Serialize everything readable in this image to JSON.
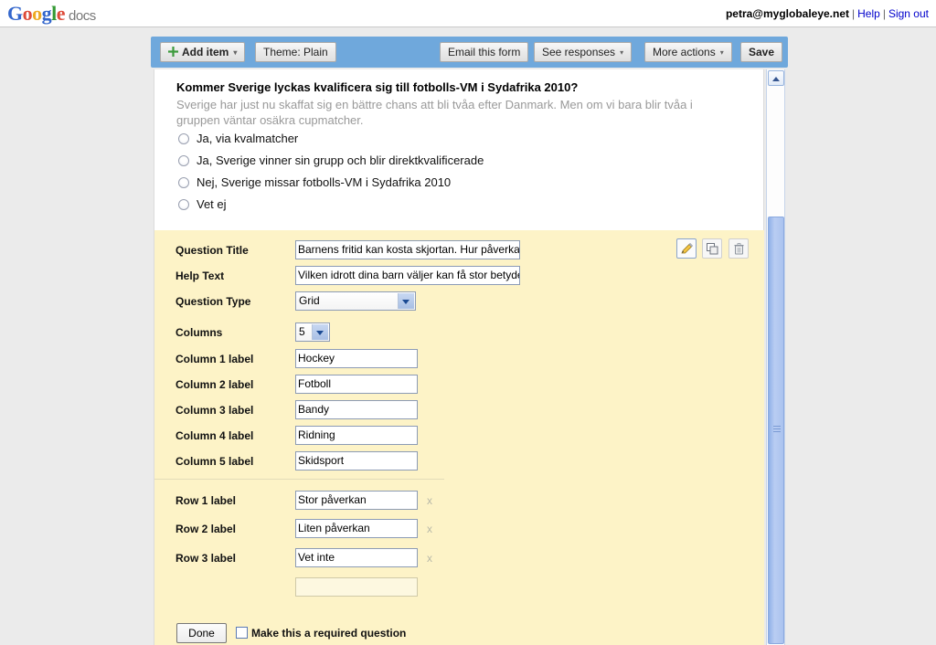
{
  "branding": {
    "google": "Google",
    "product": "docs"
  },
  "account": {
    "email": "petra@myglobaleye.net",
    "help_label": "Help",
    "signout_label": "Sign out",
    "separator": "|"
  },
  "toolbar": {
    "add_item_label": "Add item",
    "theme_label": "Theme:  Plain",
    "email_form_label": "Email this form",
    "see_responses_label": "See responses",
    "more_actions_label": "More actions",
    "save_label": "Save",
    "caret": "▾"
  },
  "preview_question": {
    "title": "Kommer Sverige lyckas kvalificera sig till fotbolls-VM i Sydafrika 2010?",
    "help_text": "Sverige har just nu skaffat sig en bättre chans att bli tvåa efter Danmark. Men om vi bara blir tvåa i gruppen väntar osäkra cupmatcher.",
    "options": [
      "Ja, via kvalmatcher",
      "Ja, Sverige vinner sin grupp och blir direktkvalificerade",
      "Nej, Sverige missar fotbolls-VM i Sydafrika 2010",
      "Vet ej"
    ]
  },
  "editor": {
    "question_title_label": "Question Title",
    "question_title_value": "Barnens fritid kan kosta skjortan. Hur påverkar",
    "help_text_label": "Help Text",
    "help_text_value": "Vilken idrott dina barn väljer kan få stor betydelse",
    "question_type_label": "Question Type",
    "question_type_value": "Grid",
    "columns_label": "Columns",
    "columns_value": "5",
    "column_rows": [
      {
        "label": "Column 1 label",
        "value": "Hockey"
      },
      {
        "label": "Column 2 label",
        "value": "Fotboll"
      },
      {
        "label": "Column 3 label",
        "value": "Bandy"
      },
      {
        "label": "Column 4 label",
        "value": "Ridning"
      },
      {
        "label": "Column 5 label",
        "value": "Skidsport"
      }
    ],
    "row_rows": [
      {
        "label": "Row 1 label",
        "value": "Stor påverkan",
        "delete": "x"
      },
      {
        "label": "Row 2 label",
        "value": "Liten påverkan",
        "delete": "x"
      },
      {
        "label": "Row 3 label",
        "value": "Vet inte",
        "delete": "x"
      }
    ],
    "new_row_value": "",
    "done_label": "Done",
    "required_label": "Make this a required question",
    "icons": {
      "edit": "pencil-icon",
      "duplicate": "duplicate-icon",
      "delete": "trash-icon"
    }
  },
  "colors": {
    "toolbar_blue": "#6fa8dc",
    "panel_yellow": "#fdf3c7",
    "page_gray": "#ebebeb",
    "link_blue": "#0000cc"
  }
}
